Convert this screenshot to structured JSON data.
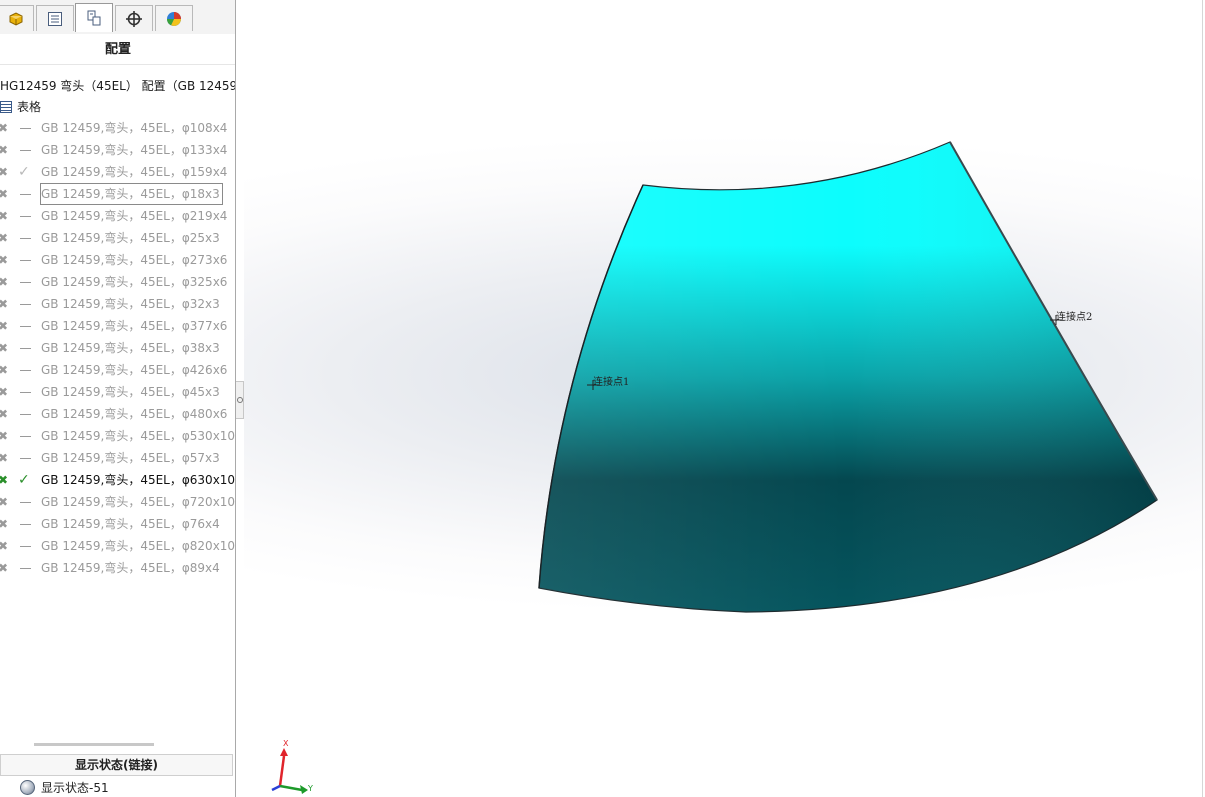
{
  "panel": {
    "tabs": [
      {
        "name": "feature-manager-icon",
        "color": "#e8b10a"
      },
      {
        "name": "property-manager-icon",
        "color": "#4a5e7d"
      },
      {
        "name": "configuration-manager-icon",
        "color": "#4a5e7d"
      },
      {
        "name": "dimxpert-icon",
        "color": "#333333"
      },
      {
        "name": "display-manager-icon",
        "color": "#d63a2a"
      }
    ],
    "active_tab": 2,
    "title": "配置",
    "root_label": "HG12459 弯头（45EL） 配置（GB 12459,弯头",
    "table_label": "表格",
    "configurations": [
      {
        "label": "GB 12459,弯头，45EL，φ108x4",
        "state": "dash"
      },
      {
        "label": "GB 12459,弯头，45EL，φ133x4",
        "state": "dash"
      },
      {
        "label": "GB 12459,弯头，45EL，φ159x4",
        "state": "check"
      },
      {
        "label": "GB 12459,弯头，45EL，φ18x3",
        "state": "dash",
        "selected": true
      },
      {
        "label": "GB 12459,弯头，45EL，φ219x4",
        "state": "dash"
      },
      {
        "label": "GB 12459,弯头，45EL，φ25x3",
        "state": "dash"
      },
      {
        "label": "GB 12459,弯头，45EL，φ273x6",
        "state": "dash"
      },
      {
        "label": "GB 12459,弯头，45EL，φ325x6",
        "state": "dash"
      },
      {
        "label": "GB 12459,弯头，45EL，φ32x3",
        "state": "dash"
      },
      {
        "label": "GB 12459,弯头，45EL，φ377x6",
        "state": "dash"
      },
      {
        "label": "GB 12459,弯头，45EL，φ38x3",
        "state": "dash"
      },
      {
        "label": "GB 12459,弯头，45EL，φ426x6",
        "state": "dash"
      },
      {
        "label": "GB 12459,弯头，45EL，φ45x3",
        "state": "dash"
      },
      {
        "label": "GB 12459,弯头，45EL，φ480x6",
        "state": "dash"
      },
      {
        "label": "GB 12459,弯头，45EL，φ530x10",
        "state": "dash"
      },
      {
        "label": "GB 12459,弯头，45EL，φ57x3",
        "state": "dash"
      },
      {
        "label": "GB 12459,弯头，45EL，φ630x10",
        "state": "check",
        "active": true
      },
      {
        "label": "GB 12459,弯头，45EL，φ720x10",
        "state": "dash"
      },
      {
        "label": "GB 12459,弯头，45EL，φ76x4",
        "state": "dash"
      },
      {
        "label": "GB 12459,弯头，45EL，φ820x10",
        "state": "dash"
      },
      {
        "label": "GB 12459,弯头，45EL，φ89x4",
        "state": "dash"
      }
    ],
    "display_states_title": "显示状态(链接)",
    "display_state": "显示状态-51"
  },
  "viewport": {
    "model_color_light": "#0cfdfd",
    "model_color_dark": "#04474f",
    "point_labels": [
      "连接点1",
      "连接点2"
    ],
    "triad": {
      "x": "X",
      "y": "Y"
    },
    "triad_colors": {
      "x": "#e0242b",
      "y": "#1d9a2a",
      "z": "#2a3fd6"
    }
  }
}
